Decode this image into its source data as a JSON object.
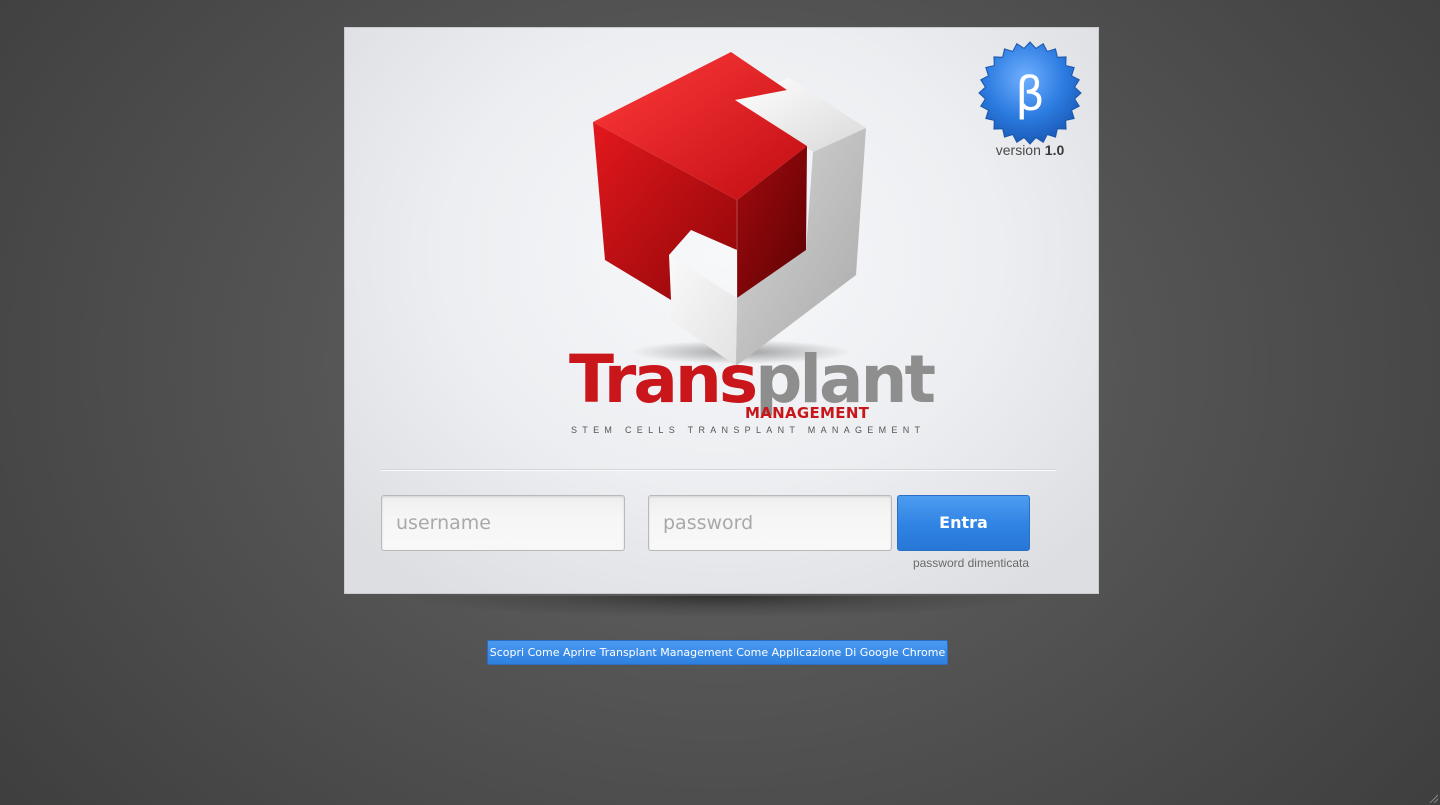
{
  "brand": {
    "name_part1": "Trans",
    "name_part2": "plant",
    "name_sub": "MANAGEMENT",
    "tagline": "STEM CELLS TRANSPLANT MANAGEMENT",
    "colors": {
      "red": "#c8161b",
      "gray": "#8e8e8e",
      "accent_blue": "#2f83e3"
    }
  },
  "badge": {
    "symbol": "β",
    "version_label": "version",
    "version_number": "1.0"
  },
  "login": {
    "username_placeholder": "username",
    "password_placeholder": "password",
    "username_value": "",
    "password_value": "",
    "submit_label": "Entra",
    "forgot_label": "password dimenticata"
  },
  "chrome_app": {
    "label": "Scopri Come Aprire Transplant Management Come Applicazione Di Google Chrome"
  },
  "icons": {
    "logo": "cube-logo-icon",
    "beta": "beta-badge-icon",
    "resize": "resize-grip-icon"
  }
}
